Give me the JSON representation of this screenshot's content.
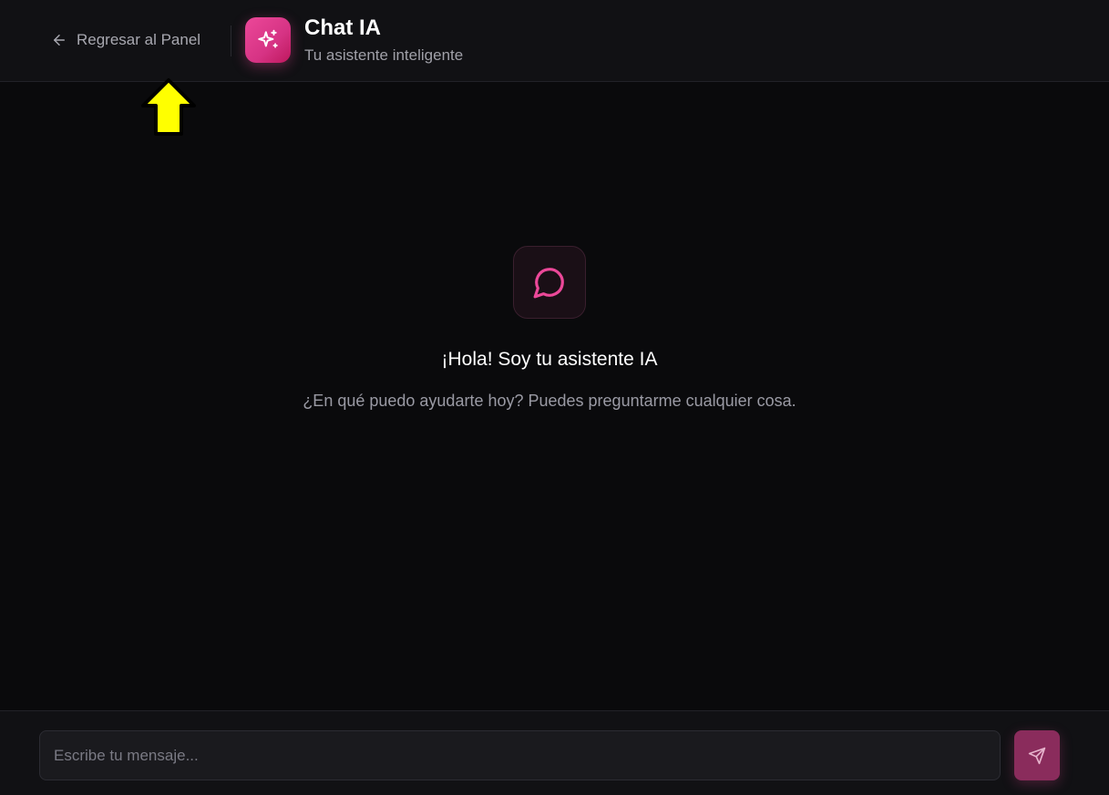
{
  "header": {
    "back_label": "Regresar al Panel",
    "title": "Chat IA",
    "subtitle": "Tu asistente inteligente",
    "app_icon": "sparkles-icon",
    "back_icon": "arrow-left-icon"
  },
  "empty_state": {
    "icon": "message-circle-icon",
    "title": "¡Hola! Soy tu asistente IA",
    "text": "¿En qué puedo ayudarte hoy? Puedes preguntarme cualquier cosa."
  },
  "composer": {
    "placeholder": "Escribe tu mensaje...",
    "value": "",
    "send_icon": "send-icon"
  },
  "annotation": {
    "icon": "pointer-arrow-icon",
    "color": "#ffff00"
  },
  "colors": {
    "accent": "#ec4899",
    "background": "#0a0a0c",
    "panel": "#111114"
  }
}
